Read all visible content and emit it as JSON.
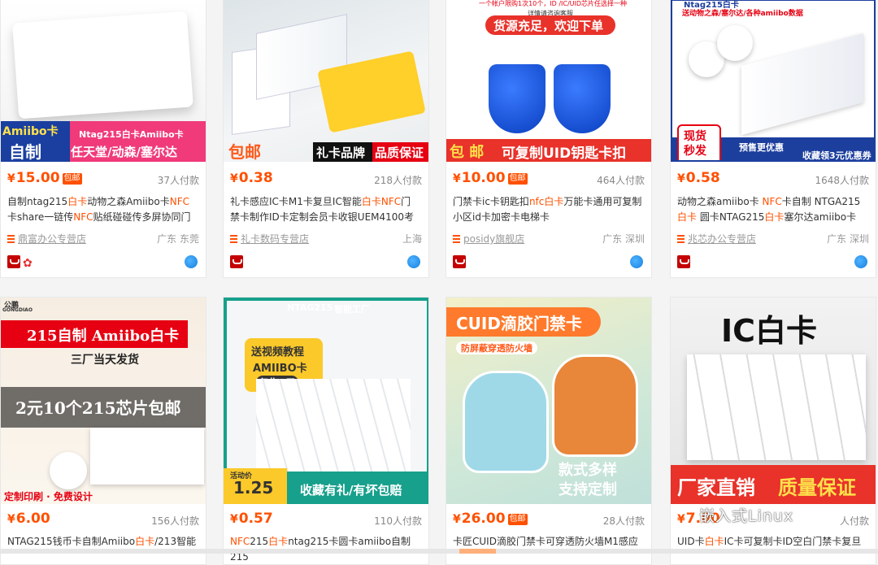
{
  "products": [
    {
      "image_text": [
        "Amiibo卡",
        "自制",
        "Ntag215白卡Amiibo卡",
        "任天堂/动森/塞尔达"
      ],
      "price": "15.00",
      "baoyou": "包邮",
      "sold": "37人付款",
      "title_parts": [
        [
          "自制ntag215",
          0
        ],
        [
          "白卡",
          1
        ],
        [
          "动物之森Amiibo卡",
          0
        ],
        [
          "NFC",
          1
        ],
        [
          "卡share一链传",
          0
        ],
        [
          "NFC",
          1
        ],
        [
          "贴纸碰碰传多屏协同门禁",
          0
        ]
      ],
      "shop": "鼎富办公专营店",
      "location": "广东 东莞",
      "badges": [
        "tmall-icon",
        "flower-icon"
      ]
    },
    {
      "image_text": [
        "包邮",
        "礼卡品牌",
        "品质保证"
      ],
      "price": "0.38",
      "baoyou": "",
      "sold": "218人付款",
      "title_parts": [
        [
          "礼卡感应IC卡M1卡复旦IC智能",
          0
        ],
        [
          "白卡",
          1
        ],
        [
          "NFC",
          1
        ],
        [
          "门禁卡制作ID卡定制会员卡收银UEM4100考",
          0
        ]
      ],
      "shop": "礼卡数码专营店",
      "location": "上海",
      "badges": [
        "tmall-icon"
      ]
    },
    {
      "image_text": [
        "一个帐户限购1次10个，ID /IC/UID芯片任选择一种",
        "详情请咨询客服",
        "货源充足，欢迎下单",
        "包 邮",
        "可复制UID钥匙卡扣"
      ],
      "price": "10.00",
      "baoyou": "包邮",
      "sold": "464人付款",
      "title_parts": [
        [
          "门禁卡ic卡钥匙扣",
          0
        ],
        [
          "nfc",
          1
        ],
        [
          "白卡",
          1
        ],
        [
          "万能卡通用可复制小区id卡加密卡电梯卡",
          0
        ]
      ],
      "shop": "posidy旗舰店",
      "location": "广东 深圳",
      "badges": [
        "tmall-icon"
      ]
    },
    {
      "image_text": [
        "Ntag215白卡",
        "送动物之森/塞尔达/各种amiibo数据",
        "现货",
        "秒发",
        "预售更优惠",
        "收藏领3元优惠券"
      ],
      "price": "0.58",
      "baoyou": "",
      "sold": "1648人付款",
      "title_parts": [
        [
          "动物之森amiibo卡 ",
          0
        ],
        [
          "NFC",
          1
        ],
        [
          "卡自制 NTGA215",
          0
        ],
        [
          "白卡",
          1
        ],
        [
          " 圆卡NTAG215",
          0
        ],
        [
          "白卡",
          1
        ],
        [
          "塞尔达amiibo卡",
          0
        ]
      ],
      "shop": "兆芯办公专营店",
      "location": "广东 深圳",
      "badges": [
        "tmall-icon"
      ]
    },
    {
      "image_text": [
        "公鹏",
        "GONGDIAO",
        "215自制 Amiibo白卡",
        "三厂当天发货",
        "2元10个215芯片包邮",
        "定制印刷 · 免费设计"
      ],
      "price": "6.00",
      "baoyou": "",
      "sold": "156人付款",
      "title_parts": [
        [
          "NTAG215钱币卡自制Amiibo",
          0
        ],
        [
          "白卡",
          1
        ],
        [
          "/213智能",
          0
        ]
      ]
    },
    {
      "image_text": [
        "NTAG215",
        "智能工厂",
        "送视频教程",
        "AMIIBO卡",
        "仅此一天",
        "活动价",
        "1.25",
        "收藏有礼/有坏包赔"
      ],
      "price": "0.57",
      "baoyou": "",
      "sold": "110人付款",
      "title_parts": [
        [
          "NFC",
          1
        ],
        [
          "215",
          0
        ],
        [
          "白卡",
          1
        ],
        [
          "ntag215卡圆卡amiibo自制215",
          0
        ]
      ]
    },
    {
      "image_text": [
        "CUID滴胶门禁卡",
        "防屏蔽穿透防火墙",
        "款式多样",
        "支持定制"
      ],
      "price": "26.00",
      "baoyou": "包邮",
      "sold": "28人付款",
      "title_parts": [
        [
          "卡匠CUID滴胶门禁卡可穿透防火墙M1感应",
          0
        ]
      ]
    },
    {
      "image_text": [
        "IC白卡",
        "厂家直销",
        "质量保证"
      ],
      "price": "7.00",
      "baoyou": "",
      "sold": "人付款",
      "title_parts": [
        [
          "UID卡",
          0
        ],
        [
          "白卡",
          1
        ],
        [
          "IC卡可复制卡ID空白门禁卡复旦",
          0
        ]
      ]
    }
  ],
  "currency": "¥",
  "watermark": "嵌入式Linux",
  "colors": {
    "accent": "#ff5000",
    "tmall": "#c40000"
  }
}
